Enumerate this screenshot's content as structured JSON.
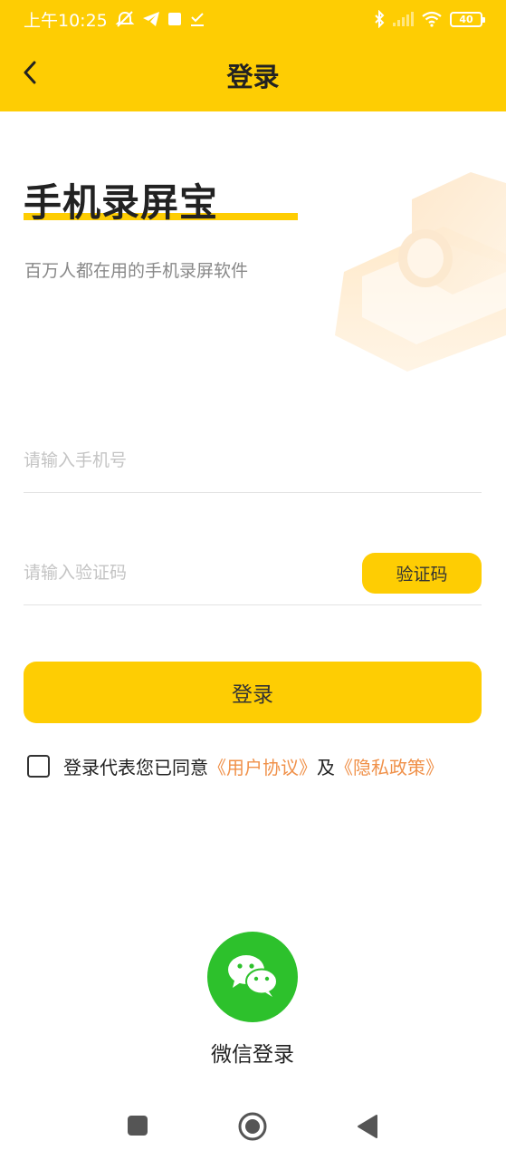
{
  "status_bar": {
    "time": "上午10:25",
    "battery": "40",
    "icons": [
      "mute-alarm-icon",
      "telegram-icon",
      "square-notification-icon",
      "download-done-icon",
      "bluetooth-icon",
      "signal-icon",
      "wifi-icon",
      "battery-icon"
    ]
  },
  "header": {
    "title": "登录",
    "back_icon": "chevron-left-icon",
    "background": "#FECD03"
  },
  "hero": {
    "app_name": "手机录屏宝",
    "subtitle": "百万人都在用的手机录屏软件",
    "illustration": "camera-illustration"
  },
  "form": {
    "phone_placeholder": "请输入手机号",
    "phone_value": "",
    "code_placeholder": "请输入验证码",
    "code_value": "",
    "code_button": "验证码",
    "login_button": "登录"
  },
  "agreement": {
    "checked": false,
    "prefix": "登录代表您已同意",
    "user_agreement": "《用户协议》",
    "conjunction": "及",
    "privacy_policy": "《隐私政策》",
    "link_color": "#F0914A"
  },
  "wechat": {
    "label": "微信登录",
    "icon": "wechat-icon",
    "color": "#2DC12C"
  },
  "system_nav": {
    "icons": [
      "recent-apps-icon",
      "home-icon",
      "back-triangle-icon"
    ]
  }
}
